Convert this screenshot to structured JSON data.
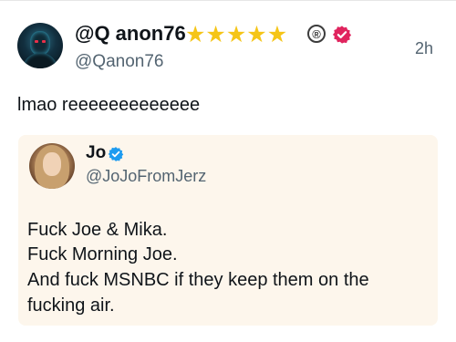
{
  "post": {
    "display_name": "@Q anon76",
    "handle": "@Qanon76",
    "timestamp": "2h",
    "text": "lmao reeeeeeeeeeeee",
    "badges": {
      "star_count": 5,
      "star_color": "#f5c518",
      "registered_mark": "®",
      "verified_color": "#e0245e"
    }
  },
  "quoted_post": {
    "display_name": "Jo",
    "handle": "@JoJoFromJerz",
    "verified_color": "#1d9bf0",
    "lines": [
      "Fuck Joe & Mika.",
      "Fuck Morning Joe.",
      "And fuck MSNBC if they keep them on the",
      "fucking air."
    ]
  }
}
